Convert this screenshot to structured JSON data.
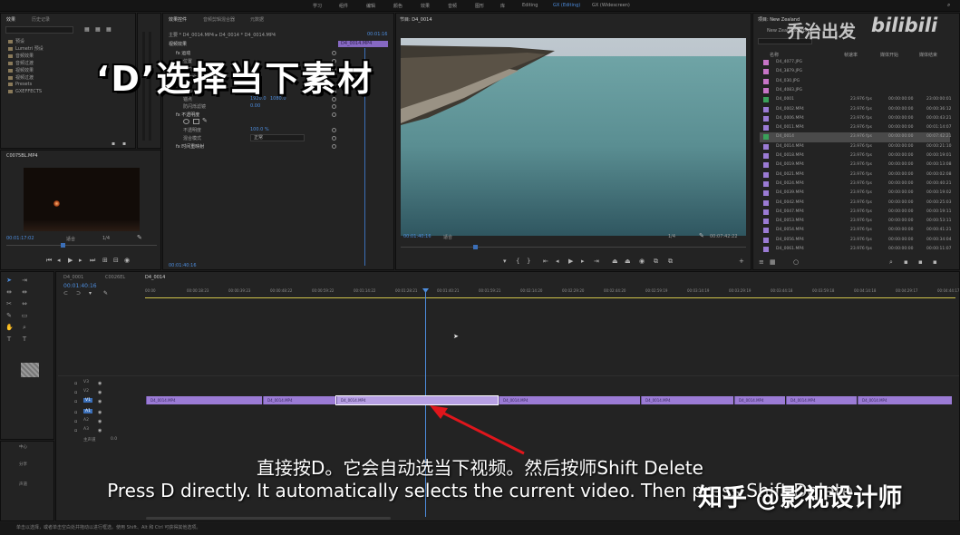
{
  "workspaces": [
    "学习",
    "组件",
    "编辑",
    "颜色",
    "效果",
    "音频",
    "图形",
    "库",
    "Editing",
    "GX (Editing)",
    "GX (Widescreen)"
  ],
  "left_panel": {
    "tabs": [
      "效果",
      "历史记录"
    ],
    "tree": [
      "预设",
      "Lumetri 预设",
      "音频效果",
      "音频过渡",
      "视频效果",
      "视频过渡",
      "Presets",
      "GXEFFECTS"
    ]
  },
  "effect_controls": {
    "tabs": [
      "效果控件",
      "音频剪辑混合器",
      "元数据"
    ],
    "header": "主要 * D4_0014.MP4 ▸ D4_0014 * D4_0014.MP4",
    "clip_name": "D4_0014.MP4",
    "timecode": "00:01:16",
    "section": "视频效果",
    "rows": [
      {
        "label": "fx 运动"
      },
      {
        "label": "位置"
      },
      {
        "label": "缩放"
      },
      {
        "label": "缩放宽度"
      },
      {
        "label": "旋转"
      },
      {
        "label": "锚点",
        "v1": "1920.0",
        "v2": "1080.0"
      },
      {
        "label": "防闪烁滤镜",
        "v1": "0.00"
      },
      {
        "label": "fx 不透明度"
      },
      {
        "label": "不透明度",
        "v1": "100.0 %"
      },
      {
        "label": "混合模式",
        "v1": "正常"
      },
      {
        "label": "fx 时间重映射"
      }
    ],
    "bottom_timecode": "00:01:40:16"
  },
  "source_monitor": {
    "tab": "C0075BL.MP4",
    "timecode": "00:01:17:02",
    "fit": "适合",
    "ratio": "1/4"
  },
  "program_monitor": {
    "tab": "节目: D4_0014",
    "timecode": "00:01:40:16",
    "fit": "适合",
    "ratio": "1/4",
    "duration": "00:07:42:22"
  },
  "project_panel": {
    "tab": "项目: New Zealand",
    "path": "New Zealand.prproj",
    "columns": [
      "名称",
      "帧速率",
      "媒体开始",
      "媒体结束"
    ],
    "rows": [
      {
        "name": "D4_4077.JPG",
        "color": "#c774c7",
        "fps": "",
        "start": "",
        "end": ""
      },
      {
        "name": "D4_3879.JPG",
        "color": "#c774c7",
        "fps": "",
        "start": "",
        "end": ""
      },
      {
        "name": "D4_030.JPG",
        "color": "#c774c7",
        "fps": "",
        "start": "",
        "end": ""
      },
      {
        "name": "D4_4083.JPG",
        "color": "#c774c7",
        "fps": "",
        "start": "",
        "end": ""
      },
      {
        "name": "D4_0001",
        "color": "#3aa15a",
        "fps": "23.976 fps",
        "start": "00:00:00:00",
        "end": "23:00:00:01"
      },
      {
        "name": "D4_0002.MP4",
        "color": "#9b7bd5",
        "fps": "23.976 fps",
        "start": "00:00:00:00",
        "end": "00:00:36:12"
      },
      {
        "name": "D4_0006.MP4",
        "color": "#9b7bd5",
        "fps": "23.976 fps",
        "start": "00:00:00:00",
        "end": "00:00:43:21"
      },
      {
        "name": "D4_0011.MP4",
        "color": "#9b7bd5",
        "fps": "23.976 fps",
        "start": "00:00:00:00",
        "end": "00:01:14:07"
      },
      {
        "name": "D4_0014",
        "color": "#3aa15a",
        "fps": "23.976 fps",
        "start": "00:00:00:00",
        "end": "00:07:42:21",
        "selected": true
      },
      {
        "name": "D4_0014.MP4",
        "color": "#9b7bd5",
        "fps": "23.976 fps",
        "start": "00:00:00:00",
        "end": "00:00:21:10"
      },
      {
        "name": "D4_0018.MP4",
        "color": "#9b7bd5",
        "fps": "23.976 fps",
        "start": "00:00:00:00",
        "end": "00:00:19:01"
      },
      {
        "name": "D4_0019.MP4",
        "color": "#9b7bd5",
        "fps": "23.976 fps",
        "start": "00:00:00:00",
        "end": "00:00:13:08"
      },
      {
        "name": "D4_0021.MP4",
        "color": "#9b7bd5",
        "fps": "23.976 fps",
        "start": "00:00:00:00",
        "end": "00:00:02:08"
      },
      {
        "name": "D4_0024.MP4",
        "color": "#9b7bd5",
        "fps": "23.976 fps",
        "start": "00:00:00:00",
        "end": "00:00:40:21"
      },
      {
        "name": "D4_0039.MP4",
        "color": "#9b7bd5",
        "fps": "23.976 fps",
        "start": "00:00:00:00",
        "end": "00:00:19:02"
      },
      {
        "name": "D4_0042.MP4",
        "color": "#9b7bd5",
        "fps": "23.976 fps",
        "start": "00:00:00:00",
        "end": "00:00:25:03"
      },
      {
        "name": "D4_0047.MP4",
        "color": "#9b7bd5",
        "fps": "23.976 fps",
        "start": "00:00:00:00",
        "end": "00:00:19:11"
      },
      {
        "name": "D4_0053.MP4",
        "color": "#9b7bd5",
        "fps": "23.976 fps",
        "start": "00:00:00:00",
        "end": "00:00:53:11"
      },
      {
        "name": "D4_0054.MP4",
        "color": "#9b7bd5",
        "fps": "23.976 fps",
        "start": "00:00:00:00",
        "end": "00:00:41:21"
      },
      {
        "name": "D4_0056.MP4",
        "color": "#9b7bd5",
        "fps": "23.976 fps",
        "start": "00:00:00:00",
        "end": "00:00:34:04"
      },
      {
        "name": "D4_0061.MP4",
        "color": "#9b7bd5",
        "fps": "23.976 fps",
        "start": "00:00:00:00",
        "end": "00:00:11:07"
      }
    ]
  },
  "timeline": {
    "tabs": [
      "D4_0001",
      "C0026EL",
      "D4_0014"
    ],
    "timecode": "00:01:40:16",
    "ruler": [
      "00:00",
      "00:00:18:23",
      "00:00:39:23",
      "00:00:48:22",
      "00:00:59:22",
      "00:01:14:22",
      "00:01:28:21",
      "00:01:40:21",
      "00:01:59:21",
      "00:02:14:20",
      "00:02:29:20",
      "00:02:44:20",
      "00:02:59:19",
      "00:03:14:19",
      "00:03:29:19",
      "00:03:44:18",
      "00:03:59:18",
      "00:04:14:18",
      "00:04:29:17",
      "00:04:44:17"
    ],
    "tracks": [
      "V3",
      "V2",
      "V1",
      "A1",
      "A2",
      "A3",
      "主声道"
    ],
    "master_value": "0.0",
    "clips": [
      "D4_0014.MP4",
      "D4_0014.MP4",
      "D4_0014.MP4",
      "D4_0014.MP4",
      "D4_0014.MP4",
      "D4_0014.MP4",
      "D4_0014.MP4",
      "D4_0014.MP4"
    ]
  },
  "meters_panel": {
    "labels": [
      "中心",
      "分享",
      "声道"
    ]
  },
  "overlays": {
    "caption": "‘D’选择当下素材",
    "subtitle_cn": "直接按D。它会自动选当下视频。然后按师Shift Delete",
    "subtitle_en": "Press D directly. It automatically selects the current video. Then press Shift Delete",
    "watermark_cn": "乔治出发",
    "watermark_logo": "bilibili",
    "watermark_zhihu": "知乎 @影视设计师"
  },
  "status_bar": "单击以选择，或者单击空白处并拖动以进行框选。使用 Shift、Alt 和 Ctrl 可获得其他选项。"
}
